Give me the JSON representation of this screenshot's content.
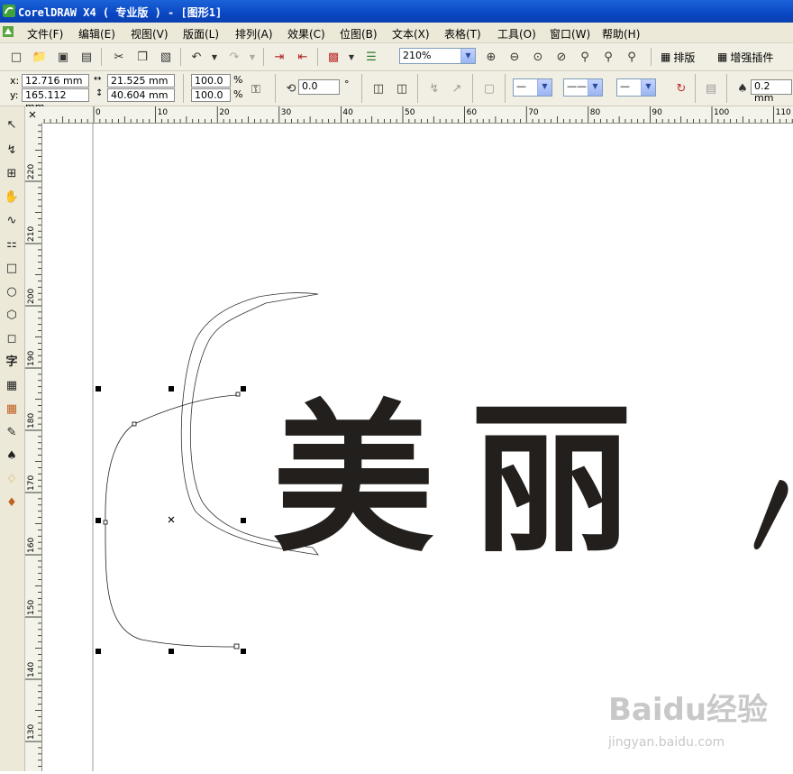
{
  "window": {
    "title": "CorelDRAW X4 ( 专业版 ) - [图形1]"
  },
  "menu": [
    "文件(F)",
    "编辑(E)",
    "视图(V)",
    "版面(L)",
    "排列(A)",
    "效果(C)",
    "位图(B)",
    "文本(X)",
    "表格(T)",
    "工具(O)",
    "窗口(W)",
    "帮助(H)"
  ],
  "standard_toolbar": {
    "zoom_level": "210%",
    "layout_label": "排版",
    "enhance_plugin_label": "增强插件"
  },
  "property_bar": {
    "x_label": "x:",
    "y_label": "y:",
    "x_value": "12.716 mm",
    "y_value": "165.112 mm",
    "width_value": "21.525 mm",
    "height_value": "40.604 mm",
    "scale_x": "100.0",
    "scale_y": "100.0",
    "percent_sign": "%",
    "rotation": "0.0",
    "degree_sign": "°",
    "outline_width": "0.2 mm"
  },
  "rulers": {
    "horizontal_ticks": [
      "0",
      "10",
      "20",
      "30",
      "40",
      "50",
      "60",
      "70",
      "80",
      "90",
      "100",
      "110"
    ],
    "vertical_ticks": [
      "220",
      "210",
      "200",
      "190",
      "180",
      "170",
      "160",
      "150",
      "140",
      "130"
    ]
  },
  "canvas": {
    "artwork_text": "美丽",
    "watermark_brand": "Baidu经验",
    "watermark_url": "jingyan.baidu.com"
  },
  "colors": {
    "titlebar": "#0a47c4",
    "glyph_fill": "#231f1c",
    "chrome": "#ece9d8"
  }
}
